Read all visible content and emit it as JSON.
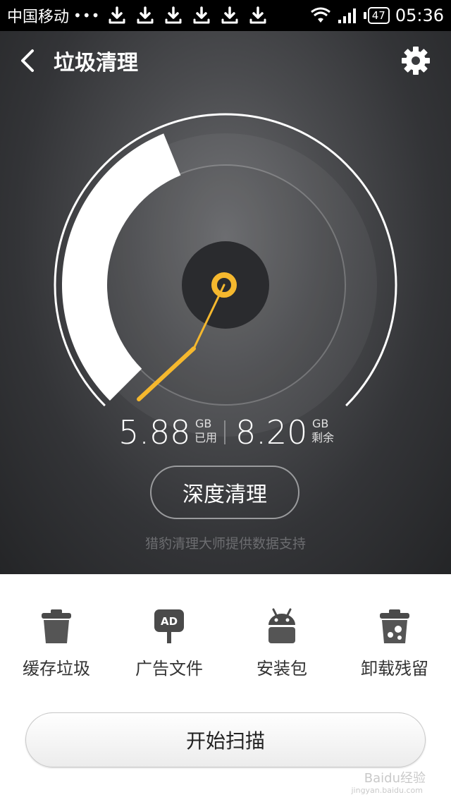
{
  "status_bar": {
    "carrier": "中国移动",
    "dots": "•••",
    "download_icon_count": 6,
    "battery": "47",
    "time": "05:36"
  },
  "header": {
    "back_icon": "chevron-left-icon",
    "title": "垃圾清理",
    "settings_icon": "gear-icon"
  },
  "gauge": {
    "used_fraction": 0.4176,
    "used_value": "5.88",
    "used_unit": "GB",
    "used_label": "已用",
    "free_value": "8.20",
    "free_unit": "GB",
    "free_label": "剩余",
    "accent_color": "#f5b82e"
  },
  "deep_clean_label": "深度清理",
  "credit": "猎豹清理大师提供数据支持",
  "categories": [
    {
      "label": "缓存垃圾",
      "icon": "trash-can-icon"
    },
    {
      "label": "广告文件",
      "icon": "ad-sign-icon"
    },
    {
      "label": "安装包",
      "icon": "android-icon"
    },
    {
      "label": "卸载残留",
      "icon": "trash-residue-icon"
    }
  ],
  "scan_button_label": "开始扫描",
  "watermark": {
    "text": "Baidu经验",
    "sub": "jingyan.baidu.com"
  }
}
